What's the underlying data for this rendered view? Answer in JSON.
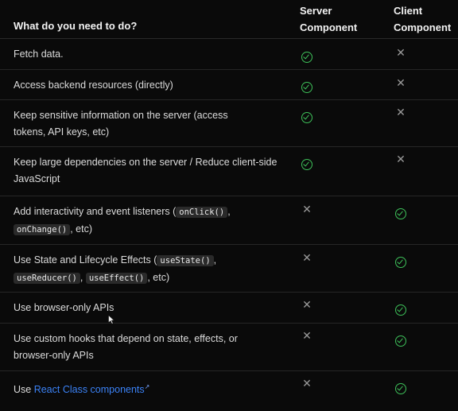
{
  "header": {
    "task_label": "What do you need to do?",
    "server_line1": "Server",
    "server_line2": "Component",
    "client_line1": "Client",
    "client_line2": "Component"
  },
  "rows": [
    {
      "text": "Fetch data.",
      "server": "check",
      "client": "cross"
    },
    {
      "text": "Access backend resources (directly)",
      "server": "check",
      "client": "cross"
    },
    {
      "text": "Keep sensitive information on the server (access tokens, API keys, etc)",
      "server": "check",
      "client": "cross"
    },
    {
      "text": "Keep large dependencies on the server / Reduce client-side JavaScript",
      "server": "check",
      "client": "cross"
    },
    {
      "text_pre": "Add interactivity and event listeners (",
      "codes": [
        "onClick()",
        "onChange()"
      ],
      "text_post": ", etc)",
      "server": "cross",
      "client": "check"
    },
    {
      "text_pre": "Use State and Lifecycle Effects (",
      "codes": [
        "useState()",
        "useReducer()",
        "useEffect()"
      ],
      "text_post": ", etc)",
      "server": "cross",
      "client": "check"
    },
    {
      "text": "Use browser-only APIs",
      "server": "cross",
      "client": "check"
    },
    {
      "text": "Use custom hooks that depend on state, effects, or browser-only APIs",
      "server": "cross",
      "client": "check"
    },
    {
      "text_pre": "Use ",
      "link": "React Class components",
      "server": "cross",
      "client": "check"
    }
  ],
  "icons": {
    "check": "check-circle-icon",
    "cross": "cross-icon",
    "external": "external-link-icon"
  },
  "colors": {
    "background": "#0a0a0a",
    "check": "#3ec25a",
    "cross": "#9a9a9a",
    "link": "#3b82f6"
  }
}
